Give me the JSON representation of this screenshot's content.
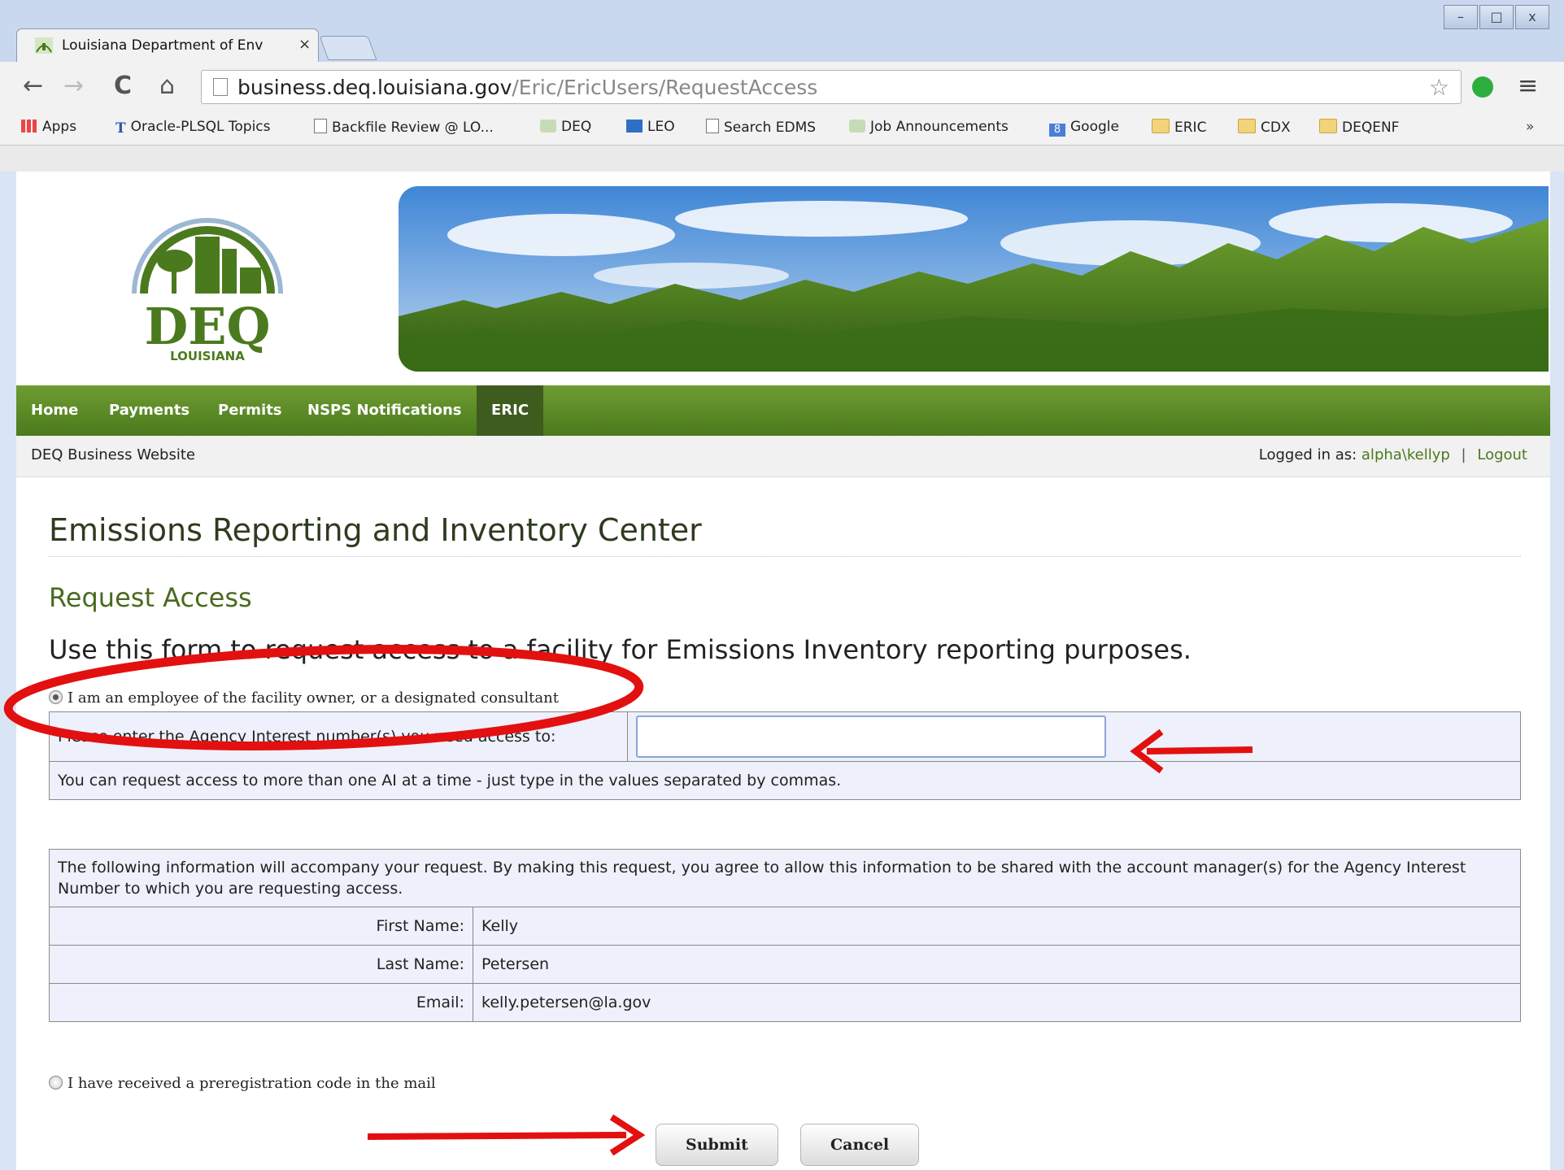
{
  "browser": {
    "tab_title": "Louisiana Department of Env",
    "tab_close": "×",
    "url_host": "business.deq.louisiana.gov",
    "url_path": "/Eric/EricUsers/RequestAccess",
    "window_controls": {
      "minimize": "–",
      "maximize": "□",
      "close": "x"
    },
    "nav": {
      "back": "←",
      "forward": "→",
      "reload": "C",
      "home": "⌂"
    },
    "star": "☆",
    "menu": "≡",
    "bookmarks": [
      {
        "label": "Apps",
        "icon": "apps-grid-icon"
      },
      {
        "label": "Oracle-PLSQL Topics",
        "icon": "t-logo-icon"
      },
      {
        "label": "Backfile Review @ LO...",
        "icon": "page-icon"
      },
      {
        "label": "DEQ",
        "icon": "deq-favicon-icon"
      },
      {
        "label": "LEO",
        "icon": "sap-icon"
      },
      {
        "label": "Search EDMS",
        "icon": "page-icon"
      },
      {
        "label": "Job Announcements",
        "icon": "deq-favicon-icon"
      },
      {
        "label": "Google",
        "icon": "google-icon"
      },
      {
        "label": "ERIC",
        "icon": "folder-icon"
      },
      {
        "label": "CDX",
        "icon": "folder-icon"
      },
      {
        "label": "DEQENF",
        "icon": "folder-icon"
      }
    ],
    "bookmarks_overflow": "»"
  },
  "site": {
    "logo_text": "DEQ",
    "logo_subtext": "LOUISIANA",
    "nav": [
      {
        "label": "Home"
      },
      {
        "label": "Payments"
      },
      {
        "label": "Permits"
      },
      {
        "label": "NSPS Notifications"
      },
      {
        "label": "ERIC",
        "active": true
      }
    ],
    "site_name": "DEQ Business Website",
    "logged_in_label": "Logged in as:",
    "username": "alpha\\kellyp",
    "separator": "|",
    "logout": "Logout"
  },
  "main": {
    "page_title": "Emissions Reporting and Inventory Center",
    "section_title": "Request Access",
    "intro": "Use this form to request access to a facility for Emissions Inventory reporting purposes.",
    "option_employee": "I am an employee of the facility owner, or a designated consultant",
    "option_employee_checked": true,
    "ai_prompt": "Please enter the Agency Interest number(s) you need access to:",
    "ai_value": "",
    "ai_hint": "You can request access to more than one AI at a time - just type in the values separated by commas.",
    "notice": "The following information will accompany your request. By making this request, you agree to allow this information to be shared with the account manager(s) for the Agency Interest Number to which you are requesting access.",
    "user_info": [
      {
        "label": "First Name:",
        "value": "Kelly"
      },
      {
        "label": "Last Name:",
        "value": "Petersen"
      },
      {
        "label": "Email:",
        "value": "kelly.petersen@la.gov"
      }
    ],
    "option_precode": "I have received a preregistration code in the mail",
    "option_precode_checked": false,
    "submit_label": "Submit",
    "cancel_label": "Cancel"
  },
  "colors": {
    "nav_green": "#5a8a25",
    "title_green": "#4a6a1f",
    "annotation_red": "#e31010"
  }
}
